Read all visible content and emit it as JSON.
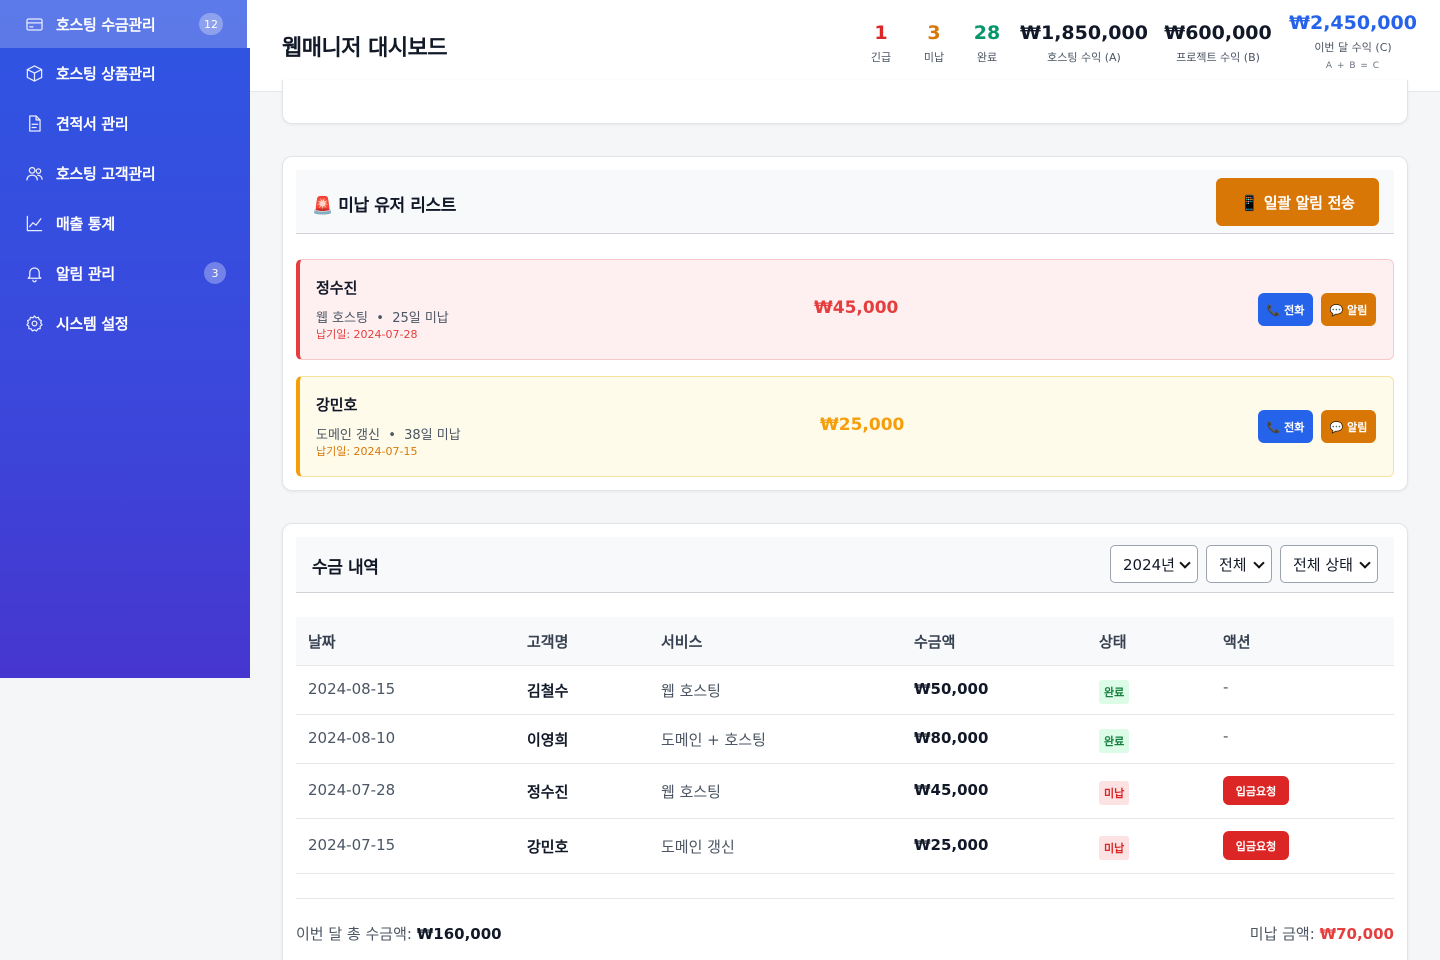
{
  "sidebar": {
    "items": [
      {
        "label": "호스팅 수금관리",
        "icon": "credit-card-icon",
        "badge": "12",
        "active": true
      },
      {
        "label": "호스팅 상품관리",
        "icon": "box-icon",
        "badge": "",
        "active": false
      },
      {
        "label": "견적서 관리",
        "icon": "document-icon",
        "badge": "",
        "active": false
      },
      {
        "label": "호스팅 고객관리",
        "icon": "users-icon",
        "badge": "",
        "active": false
      },
      {
        "label": "매출 통계",
        "icon": "line-chart-icon",
        "badge": "",
        "active": false
      },
      {
        "label": "알림 관리",
        "icon": "bell-icon",
        "badge": "3",
        "active": false
      },
      {
        "label": "시스템 설정",
        "icon": "gear-icon",
        "badge": "",
        "active": false
      }
    ]
  },
  "header": {
    "title": "웹매니저 대시보드",
    "stats": {
      "urgent": {
        "value": "1",
        "label": "긴급",
        "color": "#dc2626"
      },
      "unpaid": {
        "value": "3",
        "label": "미납",
        "color": "#d97706"
      },
      "done": {
        "value": "28",
        "label": "완료",
        "color": "#059669"
      },
      "hosting": {
        "value": "₩1,850,000",
        "label": "호스팅 수익 (A)",
        "color": "#111827"
      },
      "project": {
        "value": "₩600,000",
        "label": "프로젝트 수익 (B)",
        "color": "#111827"
      },
      "month": {
        "value": "₩2,450,000",
        "label": "이번 달 수익 (C)",
        "sub": "A + B = C",
        "color": "#2563eb"
      }
    }
  },
  "unpaid_section": {
    "title": "🚨 미납 유저 리스트",
    "bulk_button": "📱 일괄 알림 전송",
    "users": [
      {
        "name": "정수진",
        "service": "웹 호스팅",
        "overdue": "25일 미납",
        "due": "납기일: 2024-07-28",
        "amount": "₩45,000",
        "call": "📞 전화",
        "alert": "💬 알림"
      },
      {
        "name": "강민호",
        "service": "도메인 갱신",
        "overdue": "38일 미납",
        "due": "납기일: 2024-07-15",
        "amount": "₩25,000",
        "call": "📞 전화",
        "alert": "💬 알림"
      }
    ]
  },
  "history": {
    "title": "수금 내역",
    "filters": {
      "year": "2024년",
      "range": "전체",
      "status": "전체 상태"
    },
    "columns": [
      "날짜",
      "고객명",
      "서비스",
      "수금액",
      "상태",
      "액션"
    ],
    "rows": [
      {
        "date": "2024-08-15",
        "name": "김철수",
        "service": "웹 호스팅",
        "amount": "₩50,000",
        "status": "완료",
        "action": "-"
      },
      {
        "date": "2024-08-10",
        "name": "이영희",
        "service": "도메인 + 호스팅",
        "amount": "₩80,000",
        "status": "완료",
        "action": "-"
      },
      {
        "date": "2024-07-28",
        "name": "정수진",
        "service": "웹 호스팅",
        "amount": "₩45,000",
        "status": "미납",
        "action": "입금요청"
      },
      {
        "date": "2024-07-15",
        "name": "강민호",
        "service": "도메인 갱신",
        "amount": "₩25,000",
        "status": "미납",
        "action": "입금요청"
      }
    ],
    "footer": {
      "total_label": "이번 달 총 수금액: ",
      "total_value": "₩160,000",
      "unpaid_label": "미납 금액: ",
      "unpaid_value": "₩70,000",
      "unpaid_color": "#e53e3e"
    }
  }
}
